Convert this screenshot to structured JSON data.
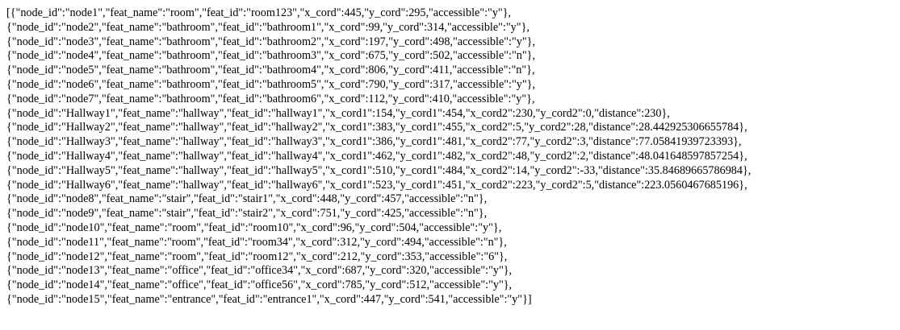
{
  "document": {
    "lines": [
      "[{\"node_id\":\"node1\",\"feat_name\":\"room\",\"feat_id\":\"room123\",\"x_cord\":445,\"y_cord\":295,\"accessible\":\"y\"},",
      "{\"node_id\":\"node2\",\"feat_name\":\"bathroom\",\"feat_id\":\"bathroom1\",\"x_cord\":99,\"y_cord\":314,\"accessible\":\"y\"},",
      "{\"node_id\":\"node3\",\"feat_name\":\"bathroom\",\"feat_id\":\"bathroom2\",\"x_cord\":197,\"y_cord\":498,\"accessible\":\"y\"},",
      "{\"node_id\":\"node4\",\"feat_name\":\"bathroom\",\"feat_id\":\"bathroom3\",\"x_cord\":675,\"y_cord\":502,\"accessible\":\"n\"},",
      "{\"node_id\":\"node5\",\"feat_name\":\"bathroom\",\"feat_id\":\"bathroom4\",\"x_cord\":806,\"y_cord\":411,\"accessible\":\"n\"},",
      "{\"node_id\":\"node6\",\"feat_name\":\"bathroom\",\"feat_id\":\"bathroom5\",\"x_cord\":790,\"y_cord\":317,\"accessible\":\"y\"},",
      "{\"node_id\":\"node7\",\"feat_name\":\"bathroom\",\"feat_id\":\"bathroom6\",\"x_cord\":112,\"y_cord\":410,\"accessible\":\"y\"},",
      "{\"node_id\":\"Hallway1\",\"feat_name\":\"hallway\",\"feat_id\":\"hallway1\",\"x_cord1\":154,\"y_cord1\":454,\"x_cord2\":230,\"y_cord2\":0,\"distance\":230},",
      "{\"node_id\":\"Hallway2\",\"feat_name\":\"hallway\",\"feat_id\":\"hallway2\",\"x_cord1\":383,\"y_cord1\":455,\"x_cord2\":5,\"y_cord2\":28,\"distance\":28.442925306655784},",
      "{\"node_id\":\"Hallway3\",\"feat_name\":\"hallway\",\"feat_id\":\"hallway3\",\"x_cord1\":386,\"y_cord1\":481,\"x_cord2\":77,\"y_cord2\":3,\"distance\":77.05841939723393},",
      "{\"node_id\":\"Hallway4\",\"feat_name\":\"hallway\",\"feat_id\":\"hallway4\",\"x_cord1\":462,\"y_cord1\":482,\"x_cord2\":48,\"y_cord2\":2,\"distance\":48.041648597857254},",
      "{\"node_id\":\"Hallway5\",\"feat_name\":\"hallway\",\"feat_id\":\"hallway5\",\"x_cord1\":510,\"y_cord1\":484,\"x_cord2\":14,\"y_cord2\":-33,\"distance\":35.84689665786984},",
      "{\"node_id\":\"Hallway6\",\"feat_name\":\"hallway\",\"feat_id\":\"hallway6\",\"x_cord1\":523,\"y_cord1\":451,\"x_cord2\":223,\"y_cord2\":5,\"distance\":223.0560467685196},",
      "{\"node_id\":\"node8\",\"feat_name\":\"stair\",\"feat_id\":\"stair1\",\"x_cord\":448,\"y_cord\":457,\"accessible\":\"n\"},",
      "{\"node_id\":\"node9\",\"feat_name\":\"stair\",\"feat_id\":\"stair2\",\"x_cord\":751,\"y_cord\":425,\"accessible\":\"n\"},",
      "{\"node_id\":\"node10\",\"feat_name\":\"room\",\"feat_id\":\"room10\",\"x_cord\":96,\"y_cord\":504,\"accessible\":\"y\"},",
      "{\"node_id\":\"node11\",\"feat_name\":\"room\",\"feat_id\":\"room34\",\"x_cord\":312,\"y_cord\":494,\"accessible\":\"n\"},",
      "{\"node_id\":\"node12\",\"feat_name\":\"room\",\"feat_id\":\"room12\",\"x_cord\":212,\"y_cord\":353,\"accessible\":\"6\"},",
      "{\"node_id\":\"node13\",\"feat_name\":\"office\",\"feat_id\":\"office34\",\"x_cord\":687,\"y_cord\":320,\"accessible\":\"y\"},",
      "{\"node_id\":\"node14\",\"feat_name\":\"office\",\"feat_id\":\"office56\",\"x_cord\":785,\"y_cord\":512,\"accessible\":\"y\"},",
      "{\"node_id\":\"node15\",\"feat_name\":\"entrance\",\"feat_id\":\"entrance1\",\"x_cord\":447,\"y_cord\":541,\"accessible\":\"y\"}]"
    ]
  }
}
